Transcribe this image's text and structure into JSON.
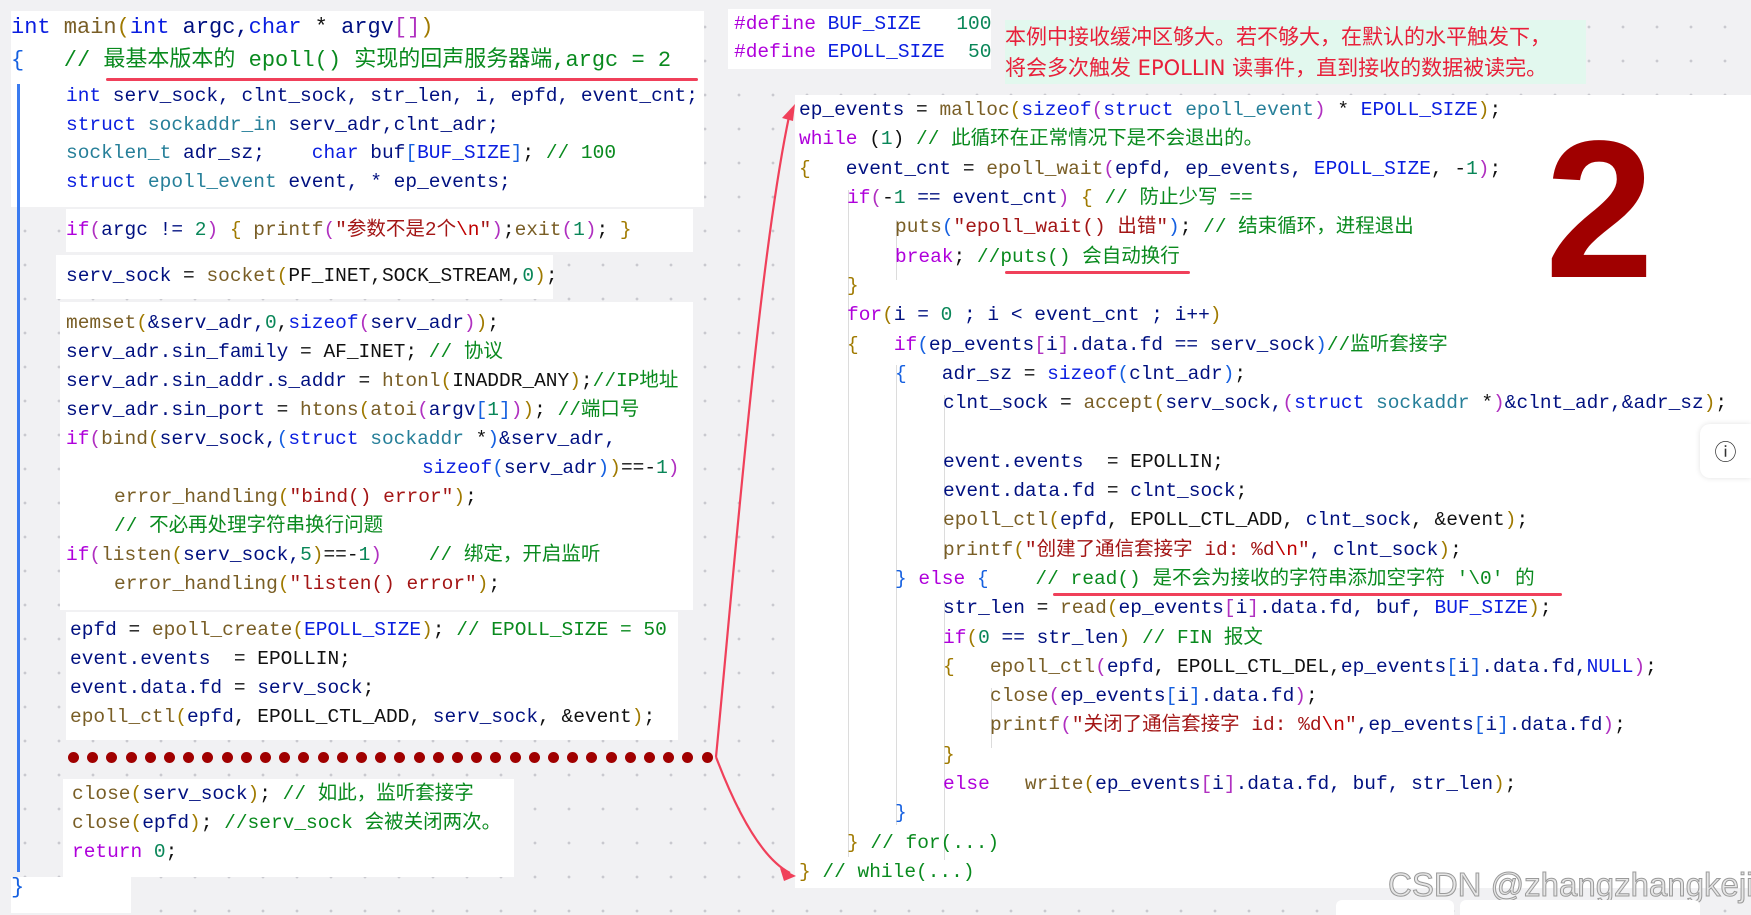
{
  "colors": {
    "keyword": "#0a1ee0",
    "control": "#af00db",
    "comment": "#098a1e",
    "string": "#a31515",
    "annotation": "#e8203a",
    "big_number": "#a00000",
    "arrow": "#f0405a",
    "dots": "#a00000"
  },
  "defines": [
    [
      [
        "#define",
        "df"
      ],
      [
        " BUF_SIZE   ",
        "mc"
      ],
      [
        "100",
        "nu"
      ]
    ],
    [
      [
        "#define",
        "df"
      ],
      [
        " EPOLL_SIZE  ",
        "mc"
      ],
      [
        "50",
        "nu"
      ]
    ]
  ],
  "annotation": {
    "line1": "本例中接收缓冲区够大。若不够大，在默认的水平触发下，",
    "line2": "将会多次触发 EPOLLIN 读事件，直到接收的数据被读完。"
  },
  "big_label": "2",
  "info_icon": "info-circle-icon",
  "info_glyph": "ⓘ",
  "watermark": "CSDN @zhangzhangkeji",
  "left_code": [
    [
      [
        "int",
        "kw"
      ],
      [
        " main",
        "fn"
      ],
      [
        "(",
        "br"
      ],
      [
        "int",
        "kw"
      ],
      [
        " argc,",
        "id"
      ],
      [
        "char",
        "kw"
      ],
      [
        " * ",
        "pl"
      ],
      [
        "argv",
        "id"
      ],
      [
        "[]",
        "br2"
      ],
      [
        ")",
        "br"
      ]
    ],
    [
      [
        "{",
        "br3"
      ],
      [
        "   // 最基本版本的 epoll() 实现的回声服务器端,argc = 2",
        "cm"
      ]
    ],
    [
      [
        "int",
        "kw"
      ],
      [
        " serv_sock, clnt_sock, str_len, i, epfd, event_cnt;",
        "id"
      ]
    ],
    [
      [
        "struct",
        "kw"
      ],
      [
        " sockaddr_in",
        "ty"
      ],
      [
        " serv_adr,clnt_adr;",
        "id"
      ]
    ],
    [
      [
        "socklen_t",
        "ty"
      ],
      [
        " adr_sz;    ",
        "id"
      ],
      [
        "char",
        "kw"
      ],
      [
        " buf",
        "id"
      ],
      [
        "[",
        "br3"
      ],
      [
        "BUF_SIZE",
        "mc"
      ],
      [
        "]",
        "br3"
      ],
      [
        ";",
        "pl"
      ],
      [
        " // 100",
        "cm"
      ]
    ],
    [
      [
        "struct",
        "kw"
      ],
      [
        " epoll_event",
        "ty"
      ],
      [
        " event, * ep_events;",
        "id"
      ]
    ],
    [
      [
        "if",
        "ctl"
      ],
      [
        "(",
        "br2"
      ],
      [
        "argc != ",
        "id"
      ],
      [
        "2",
        "nu"
      ],
      [
        ")",
        "br2"
      ],
      [
        " { ",
        "br"
      ],
      [
        "printf",
        "fn"
      ],
      [
        "(",
        "br2"
      ],
      [
        "\"参数不是2个",
        "st"
      ],
      [
        "\\n",
        "esc"
      ],
      [
        "\"",
        "st"
      ],
      [
        ")",
        "br2"
      ],
      [
        ";",
        "pl"
      ],
      [
        "exit",
        "fn"
      ],
      [
        "(",
        "br2"
      ],
      [
        "1",
        "nu"
      ],
      [
        ")",
        "br2"
      ],
      [
        "; ",
        "pl"
      ],
      [
        "}",
        "br"
      ]
    ],
    [
      [
        "serv_sock",
        "id"
      ],
      [
        " = ",
        "pl"
      ],
      [
        "socket",
        "fn"
      ],
      [
        "(",
        "br"
      ],
      [
        "PF_INET,SOCK_STREAM,",
        "pl"
      ],
      [
        "0",
        "nu"
      ],
      [
        ")",
        "br"
      ],
      [
        ";",
        "pl"
      ]
    ],
    [
      [
        "memset",
        "fn"
      ],
      [
        "(",
        "br"
      ],
      [
        "&serv_adr,",
        "id"
      ],
      [
        "0",
        "nu"
      ],
      [
        ",",
        "pl"
      ],
      [
        "sizeof",
        "kw"
      ],
      [
        "(",
        "br2"
      ],
      [
        "serv_adr",
        "id"
      ],
      [
        ")",
        "br2"
      ],
      [
        ")",
        "br"
      ],
      [
        ";",
        "pl"
      ]
    ],
    [
      [
        "serv_adr.sin_family",
        "id"
      ],
      [
        " = AF_INET; ",
        "pl"
      ],
      [
        "// 协议",
        "cm"
      ]
    ],
    [
      [
        "serv_adr.sin_addr.s_addr",
        "id"
      ],
      [
        " = ",
        "pl"
      ],
      [
        "htonl",
        "fn"
      ],
      [
        "(",
        "br"
      ],
      [
        "INADDR_ANY",
        "pl"
      ],
      [
        ")",
        "br"
      ],
      [
        ";",
        "pl"
      ],
      [
        "//IP地址",
        "cm"
      ]
    ],
    [
      [
        "serv_adr.sin_port",
        "id"
      ],
      [
        " = ",
        "pl"
      ],
      [
        "htons",
        "fn"
      ],
      [
        "(",
        "br"
      ],
      [
        "atoi",
        "fn"
      ],
      [
        "(",
        "br2"
      ],
      [
        "argv",
        "id"
      ],
      [
        "[",
        "br3"
      ],
      [
        "1",
        "nu"
      ],
      [
        "]",
        "br3"
      ],
      [
        ")",
        "br2"
      ],
      [
        ")",
        "br"
      ],
      [
        "; ",
        "pl"
      ],
      [
        "//端口号",
        "cm"
      ]
    ],
    [
      [
        "if",
        "ctl"
      ],
      [
        "(",
        "br2"
      ],
      [
        "bind",
        "fn"
      ],
      [
        "(",
        "br"
      ],
      [
        "serv_sock,",
        "id"
      ],
      [
        "(",
        "br3"
      ],
      [
        "struct",
        "kw"
      ],
      [
        " sockaddr",
        "ty"
      ],
      [
        " *",
        "pl"
      ],
      [
        ")",
        "br3"
      ],
      [
        "&serv_adr,",
        "id"
      ]
    ],
    [
      [
        "sizeof",
        "kw"
      ],
      [
        "(",
        "br3"
      ],
      [
        "serv_adr",
        "id"
      ],
      [
        ")",
        "br3"
      ],
      [
        ")",
        "br"
      ],
      [
        "==-",
        "pl"
      ],
      [
        "1",
        "nu"
      ],
      [
        ")",
        "br2"
      ]
    ],
    [
      [
        "error_handling",
        "fn"
      ],
      [
        "(",
        "br"
      ],
      [
        "\"bind() error\"",
        "st"
      ],
      [
        ")",
        "br"
      ],
      [
        ";",
        "pl"
      ]
    ],
    [
      [
        "// 不必再处理字符串换行问题",
        "cm"
      ]
    ],
    [
      [
        "if",
        "ctl"
      ],
      [
        "(",
        "br2"
      ],
      [
        "listen",
        "fn"
      ],
      [
        "(",
        "br"
      ],
      [
        "serv_sock,",
        "id"
      ],
      [
        "5",
        "nu"
      ],
      [
        ")",
        "br"
      ],
      [
        "==-",
        "pl"
      ],
      [
        "1",
        "nu"
      ],
      [
        ")",
        "br2"
      ],
      [
        "    // 绑定，开启监听",
        "cm"
      ]
    ],
    [
      [
        "error_handling",
        "fn"
      ],
      [
        "(",
        "br"
      ],
      [
        "\"listen() error\"",
        "st"
      ],
      [
        ")",
        "br"
      ],
      [
        ";",
        "pl"
      ]
    ],
    [
      [
        "epfd",
        "id"
      ],
      [
        " = ",
        "pl"
      ],
      [
        "epoll_create",
        "fn"
      ],
      [
        "(",
        "br"
      ],
      [
        "EPOLL_SIZE",
        "mc"
      ],
      [
        ")",
        "br"
      ],
      [
        "; ",
        "pl"
      ],
      [
        "// EPOLL_SIZE = 50",
        "cm"
      ]
    ],
    [
      [
        "event.events",
        "id"
      ],
      [
        "  = EPOLLIN;",
        "pl"
      ]
    ],
    [
      [
        "event.data.fd",
        "id"
      ],
      [
        " = ",
        "pl"
      ],
      [
        "serv_sock",
        "id"
      ],
      [
        ";",
        "pl"
      ]
    ],
    [
      [
        "epoll_ctl",
        "fn"
      ],
      [
        "(",
        "br"
      ],
      [
        "epfd",
        "id"
      ],
      [
        ", EPOLL_CTL_ADD, ",
        "pl"
      ],
      [
        "serv_sock",
        "id"
      ],
      [
        ", &event",
        "pl"
      ],
      [
        ")",
        "br"
      ],
      [
        ";",
        "pl"
      ]
    ],
    [
      [
        "close",
        "fn"
      ],
      [
        "(",
        "br"
      ],
      [
        "serv_sock",
        "id"
      ],
      [
        ")",
        "br"
      ],
      [
        "; ",
        "pl"
      ],
      [
        "// 如此，监听套接字",
        "cm"
      ]
    ],
    [
      [
        "close",
        "fn"
      ],
      [
        "(",
        "br"
      ],
      [
        "epfd",
        "id"
      ],
      [
        ")",
        "br"
      ],
      [
        "; ",
        "pl"
      ],
      [
        "//serv_sock 会被关闭两次。",
        "cm"
      ]
    ],
    [
      [
        "return",
        "ctl"
      ],
      [
        " ",
        "pl"
      ],
      [
        "0",
        "nu"
      ],
      [
        ";",
        "pl"
      ]
    ],
    [
      [
        "}",
        "br3"
      ]
    ]
  ],
  "right_code": [
    [
      [
        "ep_events",
        "id"
      ],
      [
        " = ",
        "pl"
      ],
      [
        "malloc",
        "fn"
      ],
      [
        "(",
        "br"
      ],
      [
        "sizeof",
        "kw"
      ],
      [
        "(",
        "br2"
      ],
      [
        "struct",
        "kw"
      ],
      [
        " epoll_event",
        "ty"
      ],
      [
        ")",
        "br2"
      ],
      [
        " * ",
        "pl"
      ],
      [
        "EPOLL_SIZE",
        "mc"
      ],
      [
        ")",
        "br"
      ],
      [
        ";",
        "pl"
      ]
    ],
    [
      [
        "while",
        "ctl"
      ],
      [
        " (",
        "pl"
      ],
      [
        "1",
        "nu"
      ],
      [
        ") ",
        "pl"
      ],
      [
        "// 此循环在正常情况下是不会退出的。",
        "cm"
      ]
    ],
    [
      [
        "{",
        "br"
      ],
      [
        "   event_cnt",
        "id"
      ],
      [
        " = ",
        "pl"
      ],
      [
        "epoll_wait",
        "fn"
      ],
      [
        "(",
        "br2"
      ],
      [
        "epfd, ep_events, ",
        "id"
      ],
      [
        "EPOLL_SIZE",
        "mc"
      ],
      [
        ", -",
        "pl"
      ],
      [
        "1",
        "nu"
      ],
      [
        ")",
        "br2"
      ],
      [
        ";",
        "pl"
      ]
    ],
    [
      [
        "if",
        "ctl"
      ],
      [
        "(",
        "br2"
      ],
      [
        "-",
        "pl"
      ],
      [
        "1",
        "nu"
      ],
      [
        " == event_cnt",
        "id"
      ],
      [
        ")",
        "br2"
      ],
      [
        " { ",
        "br"
      ],
      [
        "// 防止少写 ==",
        "cm"
      ]
    ],
    [
      [
        "puts",
        "fn"
      ],
      [
        "(",
        "br3"
      ],
      [
        "\"epoll_wait() 出错\"",
        "st"
      ],
      [
        ")",
        "br3"
      ],
      [
        "; ",
        "pl"
      ],
      [
        "// 结束循环，进程退出",
        "cm"
      ]
    ],
    [
      [
        "break",
        "ctl"
      ],
      [
        "; ",
        "pl"
      ],
      [
        "//puts() 会自动换行",
        "cm"
      ]
    ],
    [
      [
        "}",
        "br"
      ]
    ],
    [
      [
        "for",
        "ctl"
      ],
      [
        "(",
        "br"
      ],
      [
        "i = ",
        "id"
      ],
      [
        "0",
        "nu"
      ],
      [
        " ; i < event_cnt ; i++",
        "id"
      ],
      [
        ")",
        "br"
      ]
    ],
    [
      [
        "{",
        "br"
      ],
      [
        "   ",
        "pl"
      ],
      [
        "if",
        "ctl"
      ],
      [
        "(",
        "br3"
      ],
      [
        "ep_events",
        "id"
      ],
      [
        "[",
        "br2"
      ],
      [
        "i",
        "id"
      ],
      [
        "]",
        "br2"
      ],
      [
        ".data.fd == serv_sock",
        "id"
      ],
      [
        ")",
        "br3"
      ],
      [
        "//监听套接字",
        "cm"
      ]
    ],
    [
      [
        "{",
        "br3"
      ],
      [
        "   adr_sz",
        "id"
      ],
      [
        " = ",
        "pl"
      ],
      [
        "sizeof",
        "kw"
      ],
      [
        "(",
        "br3"
      ],
      [
        "clnt_adr",
        "id"
      ],
      [
        ")",
        "br3"
      ],
      [
        ";",
        "pl"
      ]
    ],
    [
      [
        "clnt_sock",
        "id"
      ],
      [
        " = ",
        "pl"
      ],
      [
        "accept",
        "fn"
      ],
      [
        "(",
        "br"
      ],
      [
        "serv_sock,",
        "id"
      ],
      [
        "(",
        "br2"
      ],
      [
        "struct",
        "kw"
      ],
      [
        " sockaddr",
        "ty"
      ],
      [
        " *",
        "pl"
      ],
      [
        ")",
        "br2"
      ],
      [
        "&clnt_adr,&adr_sz",
        "id"
      ],
      [
        ")",
        "br"
      ],
      [
        ";",
        "pl"
      ]
    ],
    [],
    [
      [
        "event.events",
        "id"
      ],
      [
        "  = EPOLLIN;",
        "pl"
      ]
    ],
    [
      [
        "event.data.fd",
        "id"
      ],
      [
        " = ",
        "pl"
      ],
      [
        "clnt_sock",
        "id"
      ],
      [
        ";",
        "pl"
      ]
    ],
    [
      [
        "epoll_ctl",
        "fn"
      ],
      [
        "(",
        "br"
      ],
      [
        "epfd",
        "id"
      ],
      [
        ", EPOLL_CTL_ADD, ",
        "pl"
      ],
      [
        "clnt_sock",
        "id"
      ],
      [
        ", &event",
        "pl"
      ],
      [
        ")",
        "br"
      ],
      [
        ";",
        "pl"
      ]
    ],
    [
      [
        "printf",
        "fn"
      ],
      [
        "(",
        "br"
      ],
      [
        "\"创建了通信套接字 id: %d",
        "st"
      ],
      [
        "\\n",
        "esc"
      ],
      [
        "\"",
        "st"
      ],
      [
        ", clnt_sock",
        "id"
      ],
      [
        ")",
        "br"
      ],
      [
        ";",
        "pl"
      ]
    ],
    [
      [
        "}",
        "br3"
      ],
      [
        " ",
        "pl"
      ],
      [
        "else",
        "ctl"
      ],
      [
        " { ",
        "br3"
      ],
      [
        "   // read() 是不会为接收的字符串添加空字符 '\\0' 的",
        "cm"
      ]
    ],
    [
      [
        "str_len",
        "id"
      ],
      [
        " = ",
        "pl"
      ],
      [
        "read",
        "fn"
      ],
      [
        "(",
        "br"
      ],
      [
        "ep_events",
        "id"
      ],
      [
        "[",
        "br2"
      ],
      [
        "i",
        "id"
      ],
      [
        "]",
        "br2"
      ],
      [
        ".data.fd, buf, ",
        "id"
      ],
      [
        "BUF_SIZE",
        "mc"
      ],
      [
        ")",
        "br"
      ],
      [
        ";",
        "pl"
      ]
    ],
    [
      [
        "if",
        "ctl"
      ],
      [
        "(",
        "br"
      ],
      [
        "0",
        "nu"
      ],
      [
        " == str_len",
        "id"
      ],
      [
        ")",
        "br"
      ],
      [
        " // FIN 报文",
        "cm"
      ]
    ],
    [
      [
        "{",
        "br"
      ],
      [
        "   ",
        "pl"
      ],
      [
        "epoll_ctl",
        "fn"
      ],
      [
        "(",
        "br2"
      ],
      [
        "epfd",
        "id"
      ],
      [
        ", EPOLL_CTL_DEL,",
        "pl"
      ],
      [
        "ep_events",
        "id"
      ],
      [
        "[",
        "br3"
      ],
      [
        "i",
        "id"
      ],
      [
        "]",
        "br3"
      ],
      [
        ".data.fd,",
        "id"
      ],
      [
        "NULL",
        "mc"
      ],
      [
        ")",
        "br2"
      ],
      [
        ";",
        "pl"
      ]
    ],
    [
      [
        "close",
        "fn"
      ],
      [
        "(",
        "br2"
      ],
      [
        "ep_events",
        "id"
      ],
      [
        "[",
        "br3"
      ],
      [
        "i",
        "id"
      ],
      [
        "]",
        "br3"
      ],
      [
        ".data.fd",
        "id"
      ],
      [
        ")",
        "br2"
      ],
      [
        ";",
        "pl"
      ]
    ],
    [
      [
        "printf",
        "fn"
      ],
      [
        "(",
        "br2"
      ],
      [
        "\"关闭了通信套接字 id: %d",
        "st"
      ],
      [
        "\\n",
        "esc"
      ],
      [
        "\"",
        "st"
      ],
      [
        ",ep_events",
        "id"
      ],
      [
        "[",
        "br3"
      ],
      [
        "i",
        "id"
      ],
      [
        "]",
        "br3"
      ],
      [
        ".data.fd",
        "id"
      ],
      [
        ")",
        "br2"
      ],
      [
        ";",
        "pl"
      ]
    ],
    [
      [
        "}",
        "br"
      ]
    ],
    [
      [
        "else",
        "ctl"
      ],
      [
        "   ",
        "pl"
      ],
      [
        "write",
        "fn"
      ],
      [
        "(",
        "br"
      ],
      [
        "ep_events",
        "id"
      ],
      [
        "[",
        "br2"
      ],
      [
        "i",
        "id"
      ],
      [
        "]",
        "br2"
      ],
      [
        ".data.fd, buf, str_len",
        "id"
      ],
      [
        ")",
        "br"
      ],
      [
        ";",
        "pl"
      ]
    ],
    [
      [
        "}",
        "br3"
      ]
    ],
    [
      [
        "}",
        "br"
      ],
      [
        " // for(...)",
        "cm"
      ]
    ],
    [
      [
        "}",
        "br"
      ],
      [
        " // while(...)",
        "cm"
      ]
    ]
  ]
}
